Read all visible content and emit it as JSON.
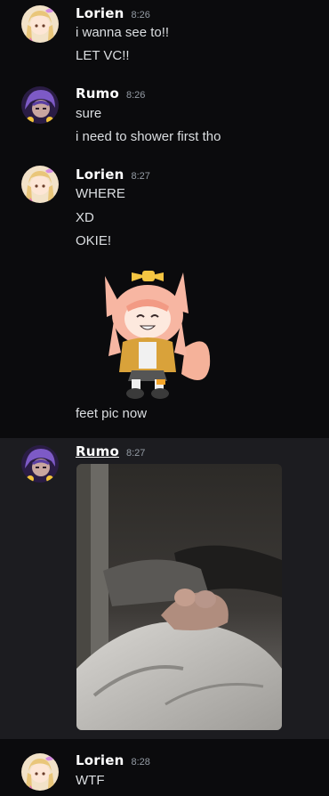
{
  "messages": [
    {
      "author": "Lorien",
      "time": "8:26",
      "lines": [
        "i wanna see to!!",
        "LET VC!!"
      ],
      "avatar_icon": "anime-girl-avatar-icon"
    },
    {
      "author": "Rumo",
      "time": "8:26",
      "lines": [
        "sure",
        "i need to shower first tho"
      ],
      "avatar_icon": "purple-hair-avatar-icon"
    },
    {
      "author": "Lorien",
      "time": "8:27",
      "lines": [
        "WHERE",
        "XD",
        "OKIE!"
      ],
      "sticker": "cat-girl-sticker",
      "after_sticker": "feet pic now",
      "avatar_icon": "anime-girl-avatar-icon"
    },
    {
      "author": "Rumo",
      "time": "8:27",
      "attachment": "photo-attachment",
      "avatar_icon": "purple-hair-avatar-icon"
    },
    {
      "author": "Lorien",
      "time": "8:28",
      "lines": [
        "WTF"
      ],
      "avatar_icon": "anime-girl-avatar-icon"
    }
  ],
  "colors": {
    "background": "#0b0b0d",
    "highlight": "#1c1c20",
    "text": "#dbdee1",
    "timestamp": "#949ba4",
    "author": "#ffffff"
  }
}
